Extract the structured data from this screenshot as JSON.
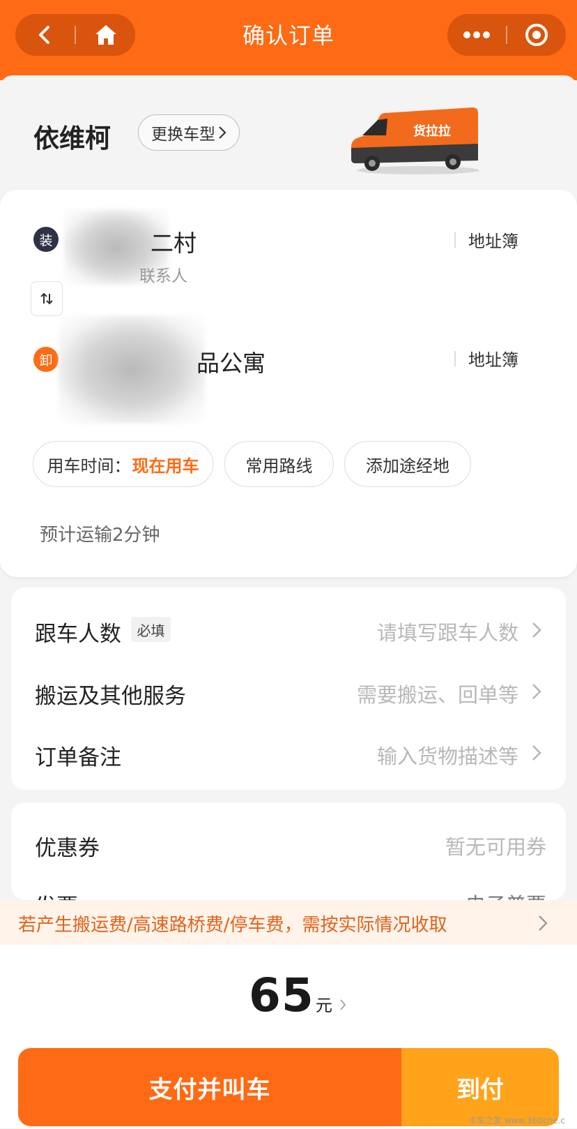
{
  "nav": {
    "title": "确认订单"
  },
  "vehicle": {
    "name": "依维柯",
    "change_label": "更换车型",
    "truck_logo_text": "货拉拉"
  },
  "route": {
    "pickup": {
      "badge": "装",
      "address_visible": "二村",
      "contact_visible": "联系人",
      "book_label": "地址簿"
    },
    "dropoff": {
      "badge": "卸",
      "address_visible": "品公寓",
      "book_label": "地址簿"
    },
    "time_chip": {
      "label": "用车时间：",
      "value": "现在用车"
    },
    "common_route_label": "常用路线",
    "add_stop_label": "添加途经地",
    "eta": "预计运输2分钟"
  },
  "options": [
    {
      "label": "跟车人数",
      "tag": "必填",
      "placeholder": "请填写跟车人数"
    },
    {
      "label": "搬运及其他服务",
      "placeholder": "需要搬运、回单等"
    },
    {
      "label": "订单备注",
      "placeholder": "输入货物描述等"
    }
  ],
  "coupon": {
    "label": "优惠券",
    "value": "暂无可用券",
    "next_label_partial": "发票",
    "next_value_partial": "电子普票"
  },
  "notice": "若产生搬运费/高速路桥费/停车费，需按实际情况收取",
  "price": {
    "amount": "65",
    "unit": "元"
  },
  "actions": {
    "pay_label": "支付并叫车",
    "cod_label": "到付"
  },
  "watermark": "卡车之家 www.360che.c",
  "colors": {
    "brand": "#ff6a14",
    "secondary_button": "#ffa31a",
    "notice_text": "#e0631b"
  }
}
